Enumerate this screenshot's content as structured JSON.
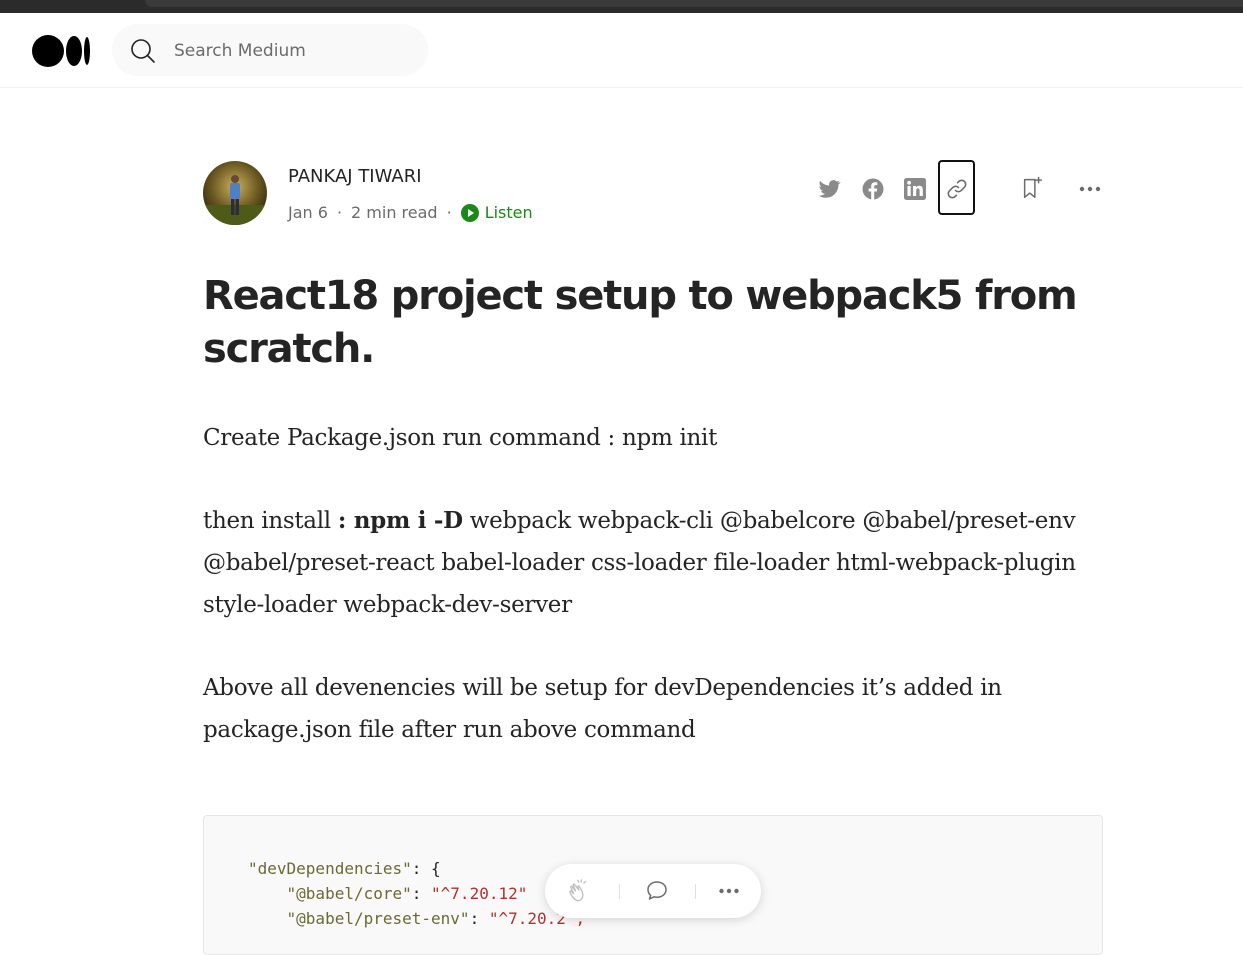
{
  "search": {
    "placeholder": "Search Medium"
  },
  "author": {
    "name": "PANKAJ TIWARI"
  },
  "meta": {
    "date": "Jan 6",
    "read_time": "2 min read",
    "separator": "·",
    "listen": "Listen"
  },
  "article": {
    "title": "React18 project setup to webpack5 from scratch.",
    "p1": "Create Package.json run command : npm init",
    "p2_prefix": "then install ",
    "p2_bold": ": npm i -D",
    "p2_rest": " webpack webpack-cli @babelcore @babel/preset-env @babel/preset-react babel-loader css-loader file-loader html-webpack-plugin style-loader webpack-dev-server",
    "p3": "Above all devenencies will be setup for devDependencies it’s added in package.json file after run above command"
  },
  "code": {
    "line1_key": "\"devDependencies\"",
    "line1_rest": ": {",
    "line2_key": "\"@babel/core\"",
    "line2_val": "\"^7.20.12\"",
    "line3_key": "\"@babel/preset-env\"",
    "line3_val": "\"^7.20.2\","
  },
  "icons": {
    "logo": "medium-logo",
    "search": "search-icon",
    "twitter": "twitter-icon",
    "facebook": "facebook-icon",
    "linkedin": "linkedin-icon",
    "link": "link-icon",
    "bookmark": "bookmark-add-icon",
    "more": "more-icon",
    "clap": "clap-icon",
    "comment": "comment-icon",
    "play": "play-icon"
  },
  "colors": {
    "accent_green": "#1a8917",
    "text": "#242424",
    "muted": "#6b6b6b"
  }
}
